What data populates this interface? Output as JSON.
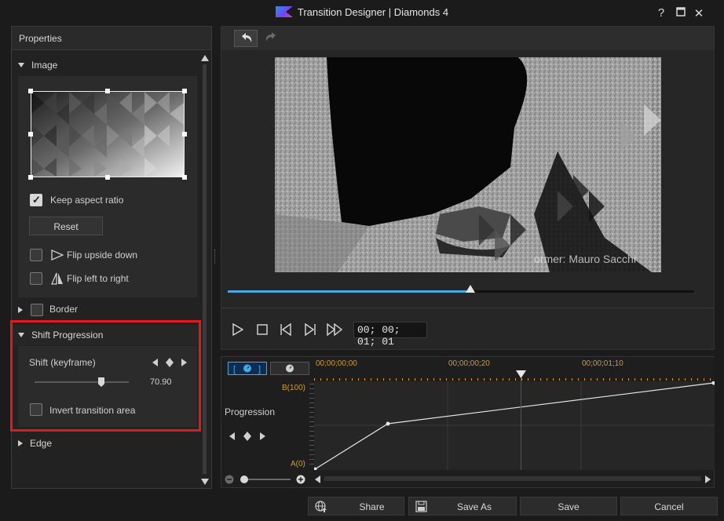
{
  "window": {
    "title": "Transition Designer  |  Diamonds 4",
    "help": "?",
    "maximize": "☐",
    "close": "✕"
  },
  "properties": {
    "header": "Properties",
    "image_section": {
      "title": "Image",
      "keep_aspect_ratio": {
        "label": "Keep aspect ratio",
        "checked": true
      },
      "reset_label": "Reset",
      "flip_upside_down": {
        "label": "Flip upside down",
        "checked": false
      },
      "flip_left_to_right": {
        "label": "Flip left to right",
        "checked": false
      }
    },
    "border_section": {
      "title": "Border",
      "checked": false
    },
    "shift_section": {
      "title": "Shift Progression",
      "shift_label": "Shift (keyframe)",
      "shift_value": "70.90",
      "slider_fraction": 0.709,
      "invert_label": "Invert transition area",
      "invert_checked": false
    },
    "edge_section": {
      "title": "Edge"
    }
  },
  "preview": {
    "watermark": "ormer: Mauro Sacchi",
    "seek_fraction": 0.52,
    "timecode": "00; 00; 01; 01"
  },
  "timeline": {
    "ticks": [
      "00;00;00;00",
      "00;00;00;20",
      "00;00;01;10"
    ],
    "track_label": "Progression",
    "label_top": "B(100)",
    "label_bottom": "A(0)"
  },
  "footer": {
    "share": "Share",
    "save_as": "Save As",
    "save": "Save",
    "cancel": "Cancel"
  },
  "colors": {
    "highlight": "#e0191b",
    "accent_blue": "#4aa8e0",
    "timeline_orange": "#d49b2a",
    "playhead": "#e0191b"
  }
}
